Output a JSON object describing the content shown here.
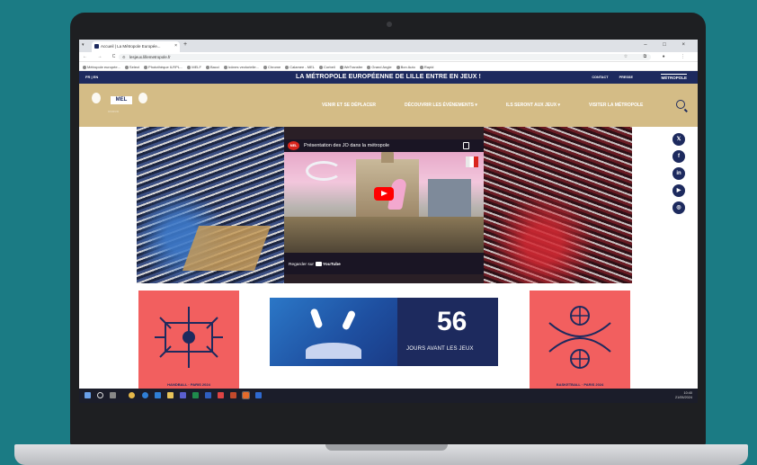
{
  "browser": {
    "tab_title": "Accueil | La Métropole Europée...",
    "tab_close": "×",
    "new_tab": "+",
    "window_controls": "– □ ×",
    "nav_buttons": "← → C ⌂",
    "url": "lesjeux.lillemetropole.fr",
    "bookmarks": [
      "Métropole europée...",
      "Select",
      "Photothèque ILRPL...",
      "MELF",
      "Bacci",
      "Icônes vectorielle...",
      "Chrome",
      "Calamee - MEL",
      "Corbeil",
      "WeTransfer",
      "Grand Angle",
      "Bon Auto",
      "Rapid"
    ]
  },
  "site": {
    "lang": "FR | EN",
    "banner": "LA MÉTROPOLE EUROPÉENNE DE LILLE ENTRE EN JEUX !",
    "top_links": [
      "CONTACT",
      "PRESSE"
    ],
    "metro_logo": "MÉTROPOLE",
    "logo_text": "MEL",
    "nav": [
      "VENIR ET SE DÉPLACER",
      "DÉCOUVRIR LES ÉVÉNEMENTS ▾",
      "ILS SERONT AUX JEUX ▾",
      "VISITER LA MÉTROPOLE"
    ]
  },
  "video": {
    "channel": "MEL",
    "title": "Présentation des JO dans la métropole",
    "watch_on": "Regarder sur",
    "youtube": "YouTube"
  },
  "social": [
    "𝕏",
    "f",
    "in",
    "▶",
    "◎"
  ],
  "tiles": {
    "left_caption": "HANDBALL · PARIS 2024",
    "right_caption": "BASKETBALL · PARIS 2024"
  },
  "countdown": {
    "number": "56",
    "text": "JOURS AVANT LES JEUX"
  },
  "taskbar": {
    "time": "10:40",
    "date": "21/05/2024"
  },
  "colors": {
    "navy": "#1d2a5e",
    "gold": "#d4bc86",
    "coral": "#f25f5f",
    "teal_bg": "#1b7b84"
  }
}
